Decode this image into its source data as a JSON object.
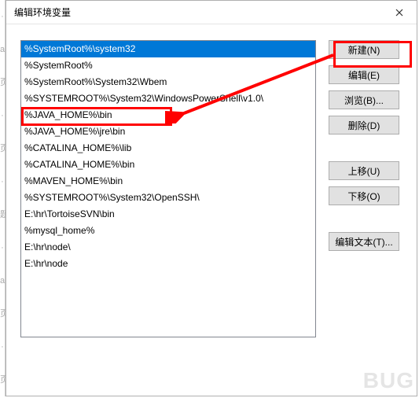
{
  "dialog": {
    "title": "编辑环境变量",
    "closeIconName": "close-icon"
  },
  "list": {
    "items": [
      "%SystemRoot%\\system32",
      "%SystemRoot%",
      "%SystemRoot%\\System32\\Wbem",
      "%SYSTEMROOT%\\System32\\WindowsPowerShell\\v1.0\\",
      "%JAVA_HOME%\\bin",
      "%JAVA_HOME%\\jre\\bin",
      "%CATALINA_HOME%\\lib",
      "%CATALINA_HOME%\\bin",
      "%MAVEN_HOME%\\bin",
      "%SYSTEMROOT%\\System32\\OpenSSH\\",
      "E:\\hr\\TortoiseSVN\\bin",
      "%mysql_home%",
      "E:\\hr\\node\\",
      "E:\\hr\\node"
    ],
    "selectedIndex": 0
  },
  "buttons": {
    "new": "新建(N)",
    "edit": "编辑(E)",
    "browse": "浏览(B)...",
    "delete": "删除(D)",
    "moveUp": "上移(U)",
    "moveDown": "下移(O)",
    "editText": "编辑文本(T)..."
  },
  "annotations": {
    "highlightNewButton": true,
    "highlightListItemIndex": 4
  },
  "watermark": "BUG"
}
